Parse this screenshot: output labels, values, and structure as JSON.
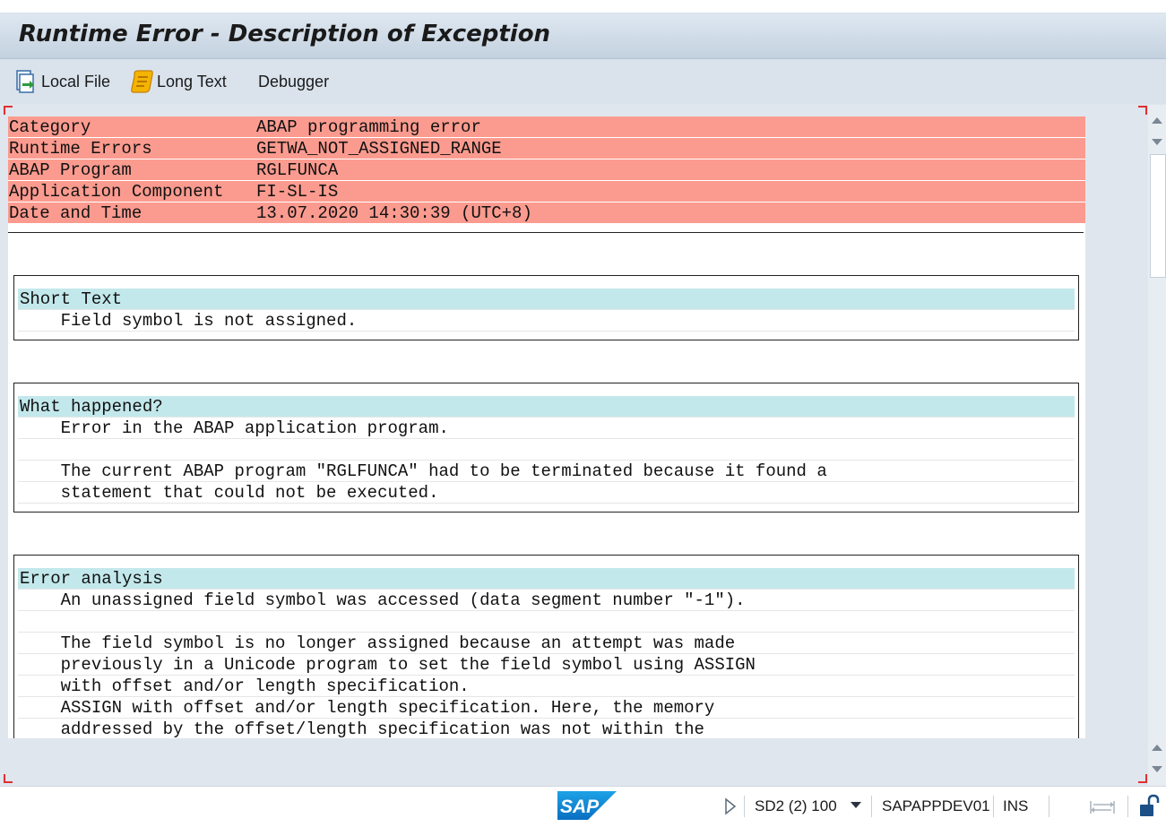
{
  "window": {
    "title": "Runtime Error - Description of Exception"
  },
  "toolbar": {
    "local_file": "Local File",
    "long_text": "Long Text",
    "debugger": "Debugger"
  },
  "header_fields": [
    {
      "label": "Category",
      "value": "ABAP programming error"
    },
    {
      "label": "Runtime Errors",
      "value": "GETWA_NOT_ASSIGNED_RANGE"
    },
    {
      "label": "ABAP Program",
      "value": "RGLFUNCA"
    },
    {
      "label": "Application Component",
      "value": "FI-SL-IS"
    },
    {
      "label": "Date and Time",
      "value": "13.07.2020 14:30:39 (UTC+8)"
    }
  ],
  "sections": {
    "short_text": {
      "heading": "Short Text",
      "lines": [
        "    Field symbol is not assigned."
      ]
    },
    "what_happened": {
      "heading": "What happened?",
      "lines": [
        "    Error in the ABAP application program.",
        "",
        "    The current ABAP program \"RGLFUNCA\" had to be terminated because it found a",
        "    statement that could not be executed."
      ]
    },
    "error_analysis": {
      "heading": "Error analysis",
      "lines": [
        "    An unassigned field symbol was accessed (data segment number \"-1\").",
        "",
        "    The field symbol is no longer assigned because an attempt was made",
        "    previously in a Unicode program to set the field symbol using ASSIGN",
        "    with offset and/or length specification.",
        "    ASSIGN with offset and/or length specification. Here, the memory",
        "    addressed by the offset/length specification was not within the"
      ]
    }
  },
  "statusbar": {
    "logo": "SAP",
    "system": "SD2 (2) 100",
    "server": "SAPAPPDEV01",
    "mode": "INS"
  },
  "colors": {
    "header_row": "#fb9b8f",
    "section_heading": "#c3e8ec",
    "titlebar": "#c3d1df"
  }
}
